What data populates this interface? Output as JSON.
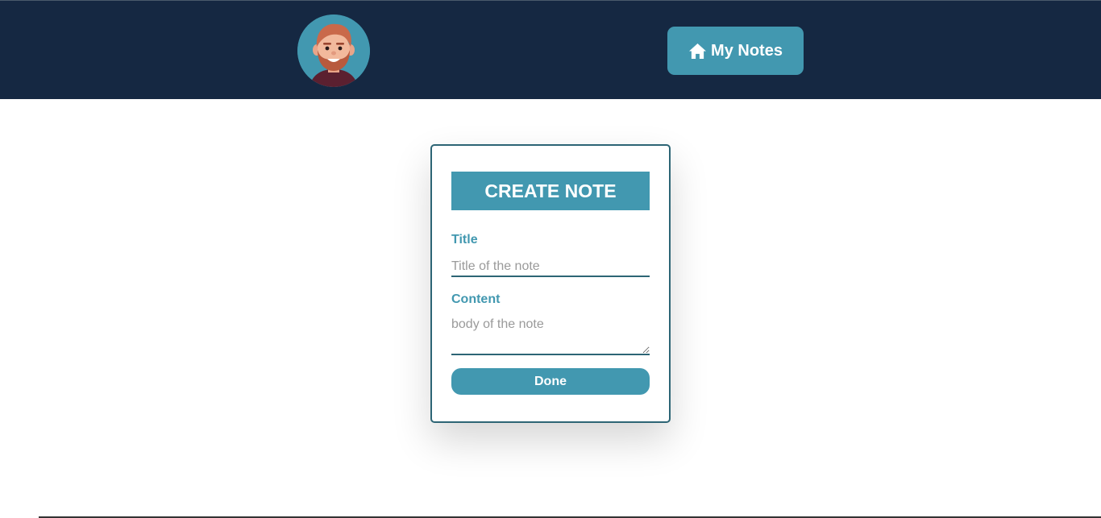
{
  "header": {
    "avatar_icon": "bearded-man-avatar",
    "nav_button": {
      "icon": "home-icon",
      "label": "My Notes"
    }
  },
  "form": {
    "title": "CREATE NOTE",
    "title_label": "Title",
    "title_placeholder": "Title of the note",
    "title_value": "",
    "content_label": "Content",
    "content_placeholder": "body of the note",
    "content_value": "",
    "submit_label": "Done"
  },
  "colors": {
    "topbar": "#152842",
    "accent": "#4298b0",
    "border": "#2d6575"
  }
}
